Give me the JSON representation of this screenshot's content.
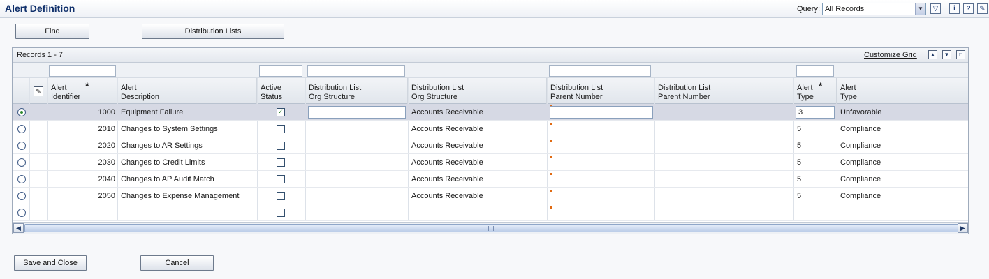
{
  "header": {
    "title": "Alert Definition",
    "query_label": "Query:",
    "query_value": "All Records",
    "icons": [
      "filter-icon",
      "info-icon",
      "help-icon",
      "pin-icon"
    ]
  },
  "toolbar": {
    "find_label": "Find",
    "distribution_lists_label": "Distribution Lists"
  },
  "grid": {
    "records_label": "Records 1 - 7",
    "customize_label": "Customize Grid",
    "columns": [
      {
        "line1": "Alert",
        "line2": "Identifier",
        "required": true
      },
      {
        "line1": "Alert",
        "line2": "Description"
      },
      {
        "line1": "Active",
        "line2": "Status"
      },
      {
        "line1": "Distribution List",
        "line2": "Org Structure"
      },
      {
        "line1": "Distribution List",
        "line2": "Org Structure"
      },
      {
        "line1": "Distribution List",
        "line2": "Parent Number"
      },
      {
        "line1": "Distribution List",
        "line2": "Parent Number"
      },
      {
        "line1": "Alert",
        "line2": "Type",
        "required": true
      },
      {
        "line1": "Alert",
        "line2": "Type"
      }
    ],
    "required_mark": "*",
    "rows": [
      {
        "selected": true,
        "id": "1000",
        "desc": "Equipment Failure",
        "active": true,
        "org": "Accounts Receivable",
        "type_code": "3",
        "type_desc": "Unfavorable"
      },
      {
        "selected": false,
        "id": "2010",
        "desc": "Changes to System Settings",
        "active": false,
        "org": "Accounts Receivable",
        "type_code": "5",
        "type_desc": "Compliance"
      },
      {
        "selected": false,
        "id": "2020",
        "desc": "Changes to AR Settings",
        "active": false,
        "org": "Accounts Receivable",
        "type_code": "5",
        "type_desc": "Compliance"
      },
      {
        "selected": false,
        "id": "2030",
        "desc": "Changes to Credit Limits",
        "active": false,
        "org": "Accounts Receivable",
        "type_code": "5",
        "type_desc": "Compliance"
      },
      {
        "selected": false,
        "id": "2040",
        "desc": "Changes to AP Audit Match",
        "active": false,
        "org": "Accounts Receivable",
        "type_code": "5",
        "type_desc": "Compliance"
      },
      {
        "selected": false,
        "id": "2050",
        "desc": "Changes to Expense Management",
        "active": false,
        "org": "Accounts Receivable",
        "type_code": "5",
        "type_desc": "Compliance"
      },
      {
        "selected": false,
        "id": "",
        "desc": "",
        "active": false,
        "org": "",
        "type_code": "",
        "type_desc": ""
      }
    ]
  },
  "footer": {
    "save_close_label": "Save and Close",
    "cancel_label": "Cancel"
  },
  "colors": {
    "title": "#10306b",
    "selected_row": "#d6d9e4",
    "parent_marker": "#e06a12"
  }
}
